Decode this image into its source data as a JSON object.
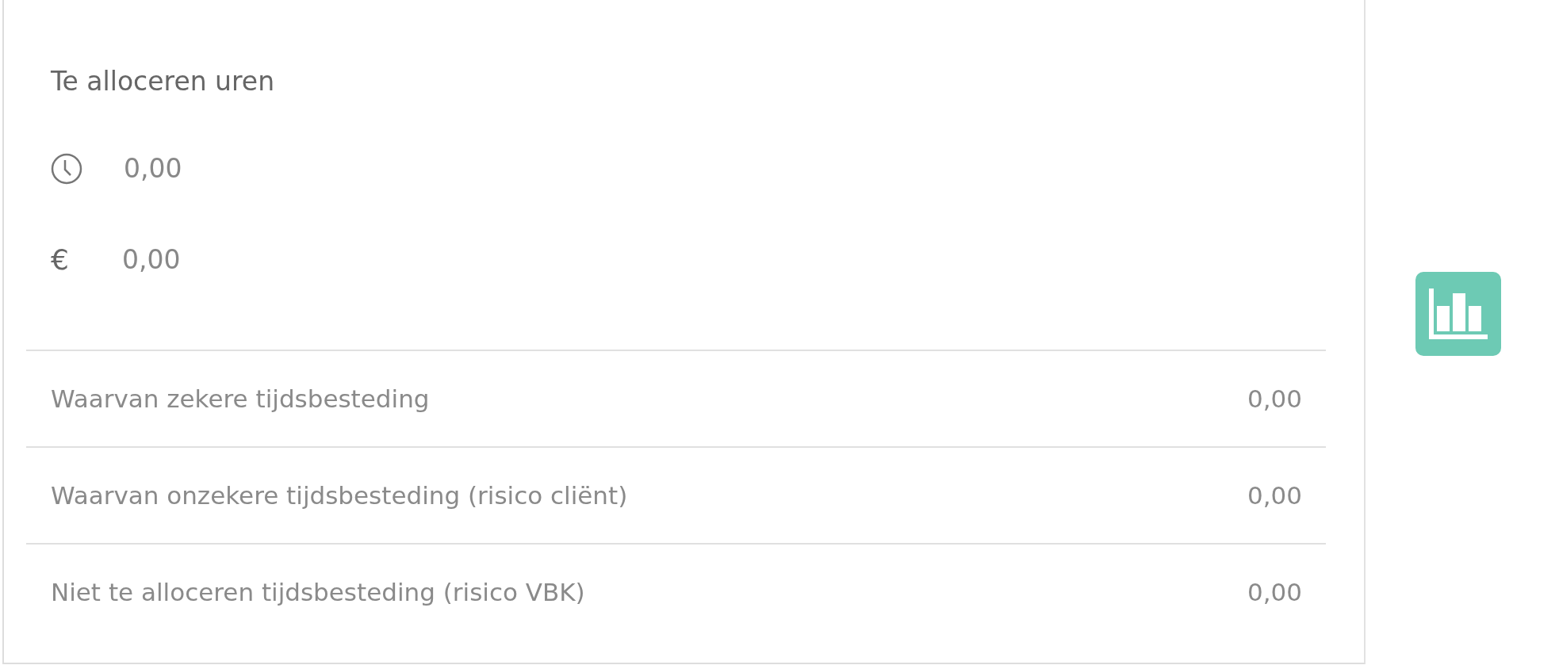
{
  "title": "Te alloceren uren",
  "totals": [
    {
      "kind": "hours",
      "value": "0,00"
    },
    {
      "kind": "amount",
      "symbol": "€",
      "value": "0,00"
    }
  ],
  "rows": [
    {
      "label": "Waarvan zekere tijdsbesteding",
      "value": "0,00"
    },
    {
      "label": "Waarvan onzekere tijdsbesteding (risico cliënt)",
      "value": "0,00"
    },
    {
      "label": "Niet te alloceren tijdsbesteding (risico VBK)",
      "value": "0,00"
    }
  ]
}
